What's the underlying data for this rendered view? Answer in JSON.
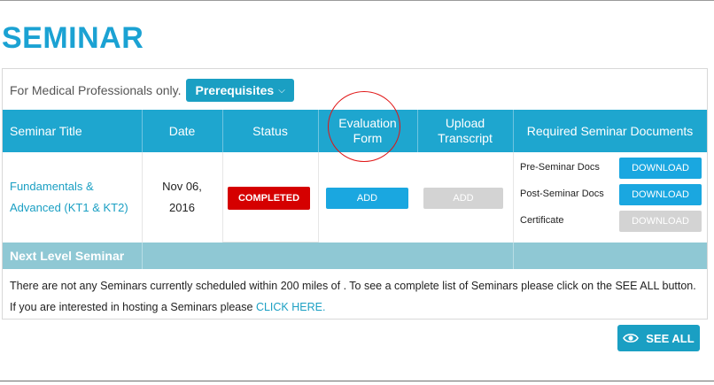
{
  "page": {
    "title": "SEMINAR"
  },
  "intro": {
    "text": "For Medical Professionals only.",
    "prerequisites_label": "Prerequisites",
    "chevron": "⌵"
  },
  "table": {
    "headers": {
      "title": "Seminar Title",
      "date": "Date",
      "status": "Status",
      "evaluation_line1": "Evaluation",
      "evaluation_line2": "Form",
      "upload_line1": "Upload",
      "upload_line2": "Transcript",
      "documents": "Required Seminar Documents"
    },
    "row": {
      "title_line1": "Fundamentals &",
      "title_line2": "Advanced (KT1 & KT2)",
      "date_line1": "Nov 06,",
      "date_line2": "2016",
      "status": "COMPLETED",
      "evaluation_button": "ADD",
      "upload_button": "ADD",
      "documents": [
        {
          "label": "Pre-Seminar Docs",
          "button": "DOWNLOAD",
          "enabled": true
        },
        {
          "label": "Post-Seminar Docs",
          "button": "DOWNLOAD",
          "enabled": true
        },
        {
          "label": "Certificate",
          "button": "DOWNLOAD",
          "enabled": false
        }
      ]
    }
  },
  "next_level": {
    "title": "Next Level Seminar",
    "notice": "There are not any Seminars currently scheduled within 200 miles of . To see a complete list of Seminars please click on the SEE ALL button. If you are interested in hosting a Seminars please",
    "link": "CLICK HERE."
  },
  "see_all": {
    "label": "SEE ALL",
    "icon": "eye-icon"
  },
  "colors": {
    "accent": "#1ea6cf",
    "title": "#1ba2d3",
    "completed": "#d50000",
    "button_active": "#1aa7e0",
    "button_disabled": "#d3d3d3",
    "next_level_bar": "#8fc8d4",
    "highlight": "#e01414"
  }
}
